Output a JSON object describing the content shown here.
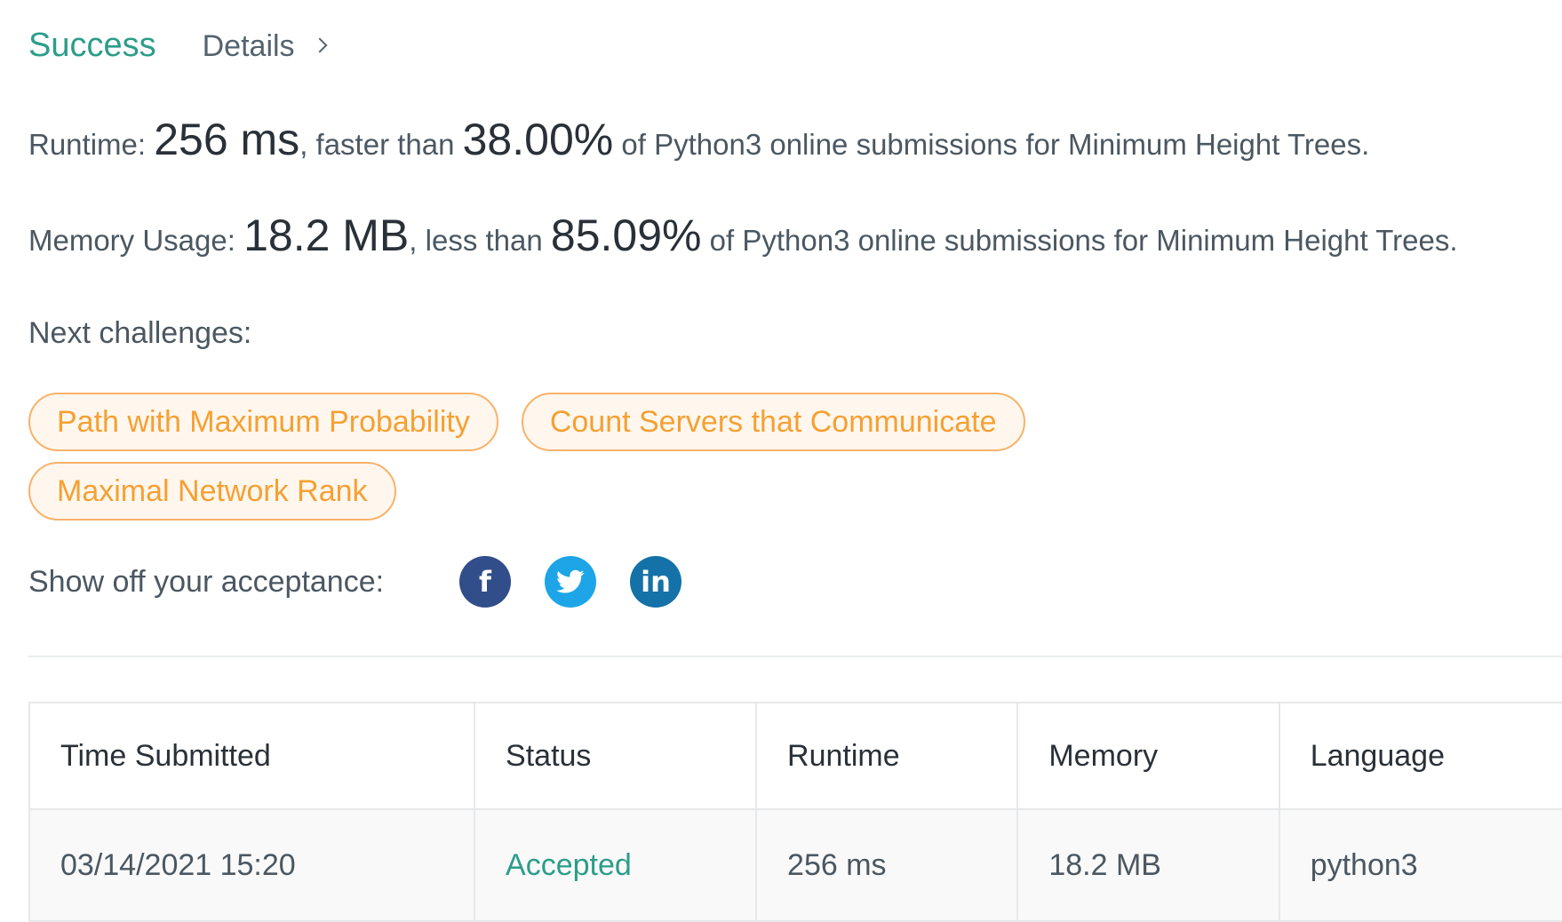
{
  "header": {
    "status": "Success",
    "details_label": "Details"
  },
  "runtime": {
    "label": "Runtime: ",
    "value": "256 ms",
    "mid": ", faster than ",
    "percent": "38.00%",
    "suffix": " of Python3 online submissions for Minimum Height Trees."
  },
  "memory": {
    "label": "Memory Usage: ",
    "value": "18.2 MB",
    "mid": ", less than ",
    "percent": "85.09%",
    "suffix": " of Python3 online submissions for Minimum Height Trees."
  },
  "next": {
    "title": "Next challenges:",
    "items": [
      "Path with Maximum Probability",
      "Count Servers that Communicate",
      "Maximal Network Rank"
    ]
  },
  "share": {
    "label": "Show off your acceptance:",
    "icons": [
      "facebook-icon",
      "twitter-icon",
      "linkedin-icon"
    ],
    "colors": {
      "facebook": "#314d8a",
      "twitter": "#1da5e8",
      "linkedin": "#1572a8"
    }
  },
  "table": {
    "headers": [
      "Time Submitted",
      "Status",
      "Runtime",
      "Memory",
      "Language"
    ],
    "rows": [
      [
        "03/14/2021 15:20",
        "Accepted",
        "256 ms",
        "18.2 MB",
        "python3"
      ]
    ]
  },
  "colors": {
    "success": "#2c9d8a",
    "challenge_chip": "#f5a033"
  }
}
